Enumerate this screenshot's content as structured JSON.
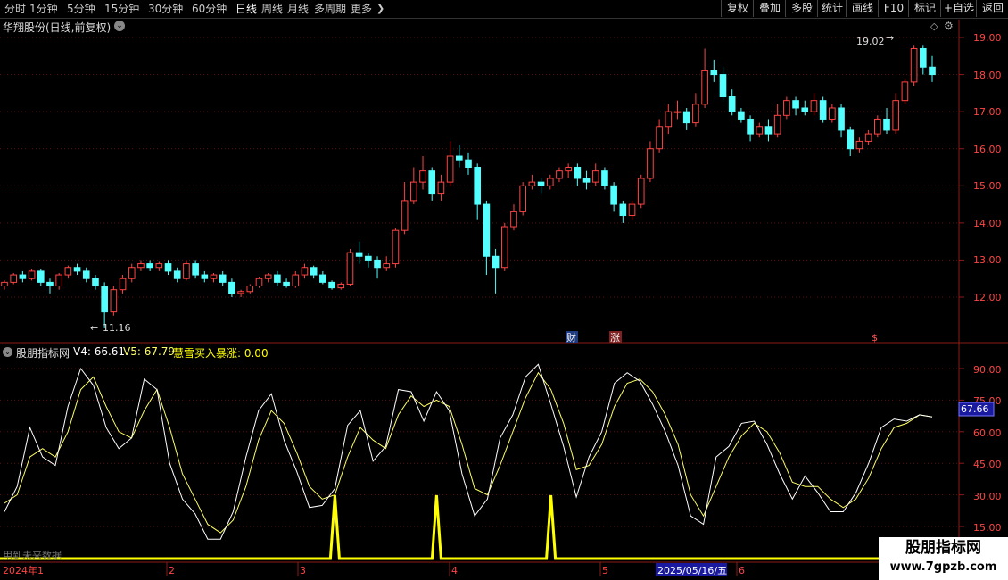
{
  "toolbar": {
    "periods": [
      "分时",
      "1分钟",
      "5分钟",
      "15分钟",
      "30分钟",
      "60分钟",
      "日线",
      "周线",
      "月线",
      "多周期",
      "更多"
    ],
    "active_period": "日线",
    "right_buttons": [
      "复权",
      "叠加",
      "多股",
      "统计",
      "画线",
      "F10",
      "标记",
      "+自选",
      "返回"
    ]
  },
  "chart": {
    "title": "华翔股份(日线,前复权)",
    "price_ticks": [
      "19.00",
      "18.00",
      "17.00",
      "16.00",
      "15.00",
      "14.00",
      "13.00",
      "12.00"
    ],
    "high_marker": "19.02",
    "low_marker": "11.16",
    "event_markers": [
      "财",
      "涨",
      "$"
    ]
  },
  "indicator": {
    "name": "股朋指标网",
    "v4_label": "V4: 66.61",
    "v5_label": "V5: 67.79",
    "signal_label": "慧雪买入暴涨: 0.00",
    "ticks": [
      "90.00",
      "75.00",
      "60.00",
      "45.00",
      "30.00",
      "15.00"
    ],
    "current_value": "67.66",
    "colors": {
      "v4": "#ffffff",
      "v5": "#ffff66",
      "signal": "#ffff00",
      "up": "#ff4444",
      "down": "#54ffff"
    }
  },
  "footer": {
    "note": "用到未来数据",
    "date_labels": [
      "2024年1",
      "2",
      "3",
      "4",
      "5",
      "6"
    ],
    "cursor_date": "2025/05/16/五"
  },
  "watermark": {
    "line1": "股朋指标网",
    "line2": "www.7gpzb.com"
  },
  "chart_data": {
    "type": "candlestick",
    "y_axis_ticks": [
      12,
      13,
      14,
      15,
      16,
      17,
      18,
      19
    ],
    "candles": [
      [
        12.3,
        12.4,
        12.2,
        12.45
      ],
      [
        12.4,
        12.6,
        12.35,
        12.65
      ],
      [
        12.6,
        12.5,
        12.4,
        12.7
      ],
      [
        12.5,
        12.7,
        12.45,
        12.75
      ],
      [
        12.7,
        12.4,
        12.3,
        12.75
      ],
      [
        12.4,
        12.3,
        12.1,
        12.5
      ],
      [
        12.3,
        12.6,
        12.2,
        12.65
      ],
      [
        12.6,
        12.8,
        12.5,
        12.85
      ],
      [
        12.8,
        12.7,
        12.6,
        12.9
      ],
      [
        12.7,
        12.5,
        12.4,
        12.8
      ],
      [
        12.5,
        12.3,
        12.2,
        12.6
      ],
      [
        12.3,
        11.6,
        11.16,
        12.4
      ],
      [
        11.6,
        12.2,
        11.5,
        12.3
      ],
      [
        12.2,
        12.5,
        12.1,
        12.6
      ],
      [
        12.5,
        12.8,
        12.4,
        12.9
      ],
      [
        12.8,
        12.9,
        12.7,
        13.0
      ],
      [
        12.9,
        12.8,
        12.7,
        13.0
      ],
      [
        12.8,
        12.9,
        12.7,
        12.95
      ],
      [
        12.9,
        12.7,
        12.6,
        13.0
      ],
      [
        12.7,
        12.5,
        12.4,
        12.8
      ],
      [
        12.5,
        12.9,
        12.45,
        13.0
      ],
      [
        12.9,
        12.6,
        12.5,
        13.0
      ],
      [
        12.6,
        12.5,
        12.4,
        12.7
      ],
      [
        12.5,
        12.6,
        12.4,
        12.65
      ],
      [
        12.6,
        12.4,
        12.3,
        12.7
      ],
      [
        12.4,
        12.1,
        12.0,
        12.5
      ],
      [
        12.1,
        12.15,
        12.0,
        12.2
      ],
      [
        12.15,
        12.3,
        12.1,
        12.35
      ],
      [
        12.3,
        12.5,
        12.25,
        12.55
      ],
      [
        12.5,
        12.6,
        12.4,
        12.65
      ],
      [
        12.6,
        12.4,
        12.3,
        12.7
      ],
      [
        12.4,
        12.3,
        12.25,
        12.5
      ],
      [
        12.3,
        12.6,
        12.25,
        12.7
      ],
      [
        12.6,
        12.8,
        12.5,
        12.9
      ],
      [
        12.8,
        12.6,
        12.5,
        12.85
      ],
      [
        12.6,
        12.4,
        12.35,
        12.7
      ],
      [
        12.4,
        12.25,
        12.2,
        12.45
      ],
      [
        12.25,
        12.35,
        12.2,
        12.4
      ],
      [
        12.35,
        13.2,
        12.3,
        13.3
      ],
      [
        13.2,
        13.1,
        12.9,
        13.5
      ],
      [
        13.1,
        13.0,
        12.8,
        13.2
      ],
      [
        13.0,
        12.8,
        12.5,
        13.1
      ],
      [
        12.8,
        12.9,
        12.7,
        13.1
      ],
      [
        12.9,
        13.8,
        12.8,
        13.85
      ],
      [
        13.8,
        14.6,
        13.7,
        15.1
      ],
      [
        14.6,
        15.1,
        14.5,
        15.5
      ],
      [
        15.1,
        15.4,
        14.9,
        15.8
      ],
      [
        15.4,
        14.8,
        14.6,
        15.5
      ],
      [
        14.8,
        15.1,
        14.6,
        15.3
      ],
      [
        15.1,
        15.8,
        15.0,
        16.2
      ],
      [
        15.8,
        15.7,
        15.5,
        16.1
      ],
      [
        15.7,
        15.5,
        15.3,
        15.9
      ],
      [
        15.5,
        14.5,
        14.1,
        15.6
      ],
      [
        14.5,
        13.1,
        12.6,
        14.6
      ],
      [
        13.1,
        12.8,
        12.1,
        13.3
      ],
      [
        12.8,
        13.9,
        12.7,
        14.0
      ],
      [
        13.9,
        14.3,
        13.8,
        14.5
      ],
      [
        14.3,
        15.0,
        14.2,
        15.1
      ],
      [
        15.0,
        15.1,
        14.9,
        15.3
      ],
      [
        15.1,
        15.0,
        14.8,
        15.2
      ],
      [
        15.0,
        15.2,
        14.9,
        15.3
      ],
      [
        15.2,
        15.4,
        15.1,
        15.5
      ],
      [
        15.4,
        15.5,
        15.2,
        15.6
      ],
      [
        15.5,
        15.2,
        15.0,
        15.6
      ],
      [
        15.2,
        15.1,
        14.9,
        15.4
      ],
      [
        15.1,
        15.4,
        15.0,
        15.6
      ],
      [
        15.4,
        15.0,
        14.9,
        15.5
      ],
      [
        15.0,
        14.5,
        14.3,
        15.1
      ],
      [
        14.5,
        14.2,
        14.0,
        14.6
      ],
      [
        14.2,
        14.5,
        14.1,
        14.6
      ],
      [
        14.5,
        15.2,
        14.4,
        15.3
      ],
      [
        15.2,
        16.0,
        15.1,
        16.2
      ],
      [
        16.0,
        16.6,
        15.9,
        16.8
      ],
      [
        16.6,
        17.0,
        16.4,
        17.2
      ],
      [
        17.0,
        17.0,
        16.8,
        17.3
      ],
      [
        17.0,
        16.7,
        16.5,
        17.1
      ],
      [
        16.7,
        17.2,
        16.6,
        17.5
      ],
      [
        17.2,
        18.1,
        17.1,
        18.7
      ],
      [
        18.1,
        18.0,
        17.8,
        18.4
      ],
      [
        18.0,
        17.4,
        17.3,
        18.2
      ],
      [
        17.4,
        17.0,
        16.9,
        17.6
      ],
      [
        17.0,
        16.8,
        16.7,
        17.1
      ],
      [
        16.8,
        16.4,
        16.2,
        16.9
      ],
      [
        16.4,
        16.6,
        16.3,
        16.7
      ],
      [
        16.6,
        16.4,
        16.2,
        16.8
      ],
      [
        16.4,
        16.9,
        16.3,
        17.2
      ],
      [
        16.9,
        17.3,
        16.8,
        17.4
      ],
      [
        17.3,
        17.1,
        16.9,
        17.4
      ],
      [
        17.1,
        17.0,
        16.9,
        17.3
      ],
      [
        17.0,
        17.3,
        16.9,
        17.5
      ],
      [
        17.3,
        16.8,
        16.7,
        17.4
      ],
      [
        16.8,
        17.1,
        16.7,
        17.2
      ],
      [
        17.1,
        16.5,
        16.3,
        17.2
      ],
      [
        16.5,
        16.0,
        15.8,
        16.6
      ],
      [
        16.0,
        16.2,
        15.9,
        16.3
      ],
      [
        16.2,
        16.4,
        16.1,
        16.5
      ],
      [
        16.4,
        16.8,
        16.3,
        16.9
      ],
      [
        16.8,
        16.5,
        16.4,
        17.1
      ],
      [
        16.5,
        17.3,
        16.4,
        17.5
      ],
      [
        17.3,
        17.8,
        17.2,
        17.9
      ],
      [
        17.8,
        18.7,
        17.7,
        18.8
      ],
      [
        18.7,
        18.2,
        18.0,
        18.8
      ],
      [
        18.2,
        18.0,
        17.8,
        18.5
      ]
    ],
    "v4": [
      22,
      34,
      62,
      48,
      44,
      72,
      90,
      82,
      62,
      52,
      57,
      85,
      80,
      45,
      28,
      21,
      9,
      9,
      22,
      48,
      70,
      78,
      56,
      41,
      24,
      25,
      33,
      63,
      70,
      46,
      53,
      80,
      79,
      65,
      79,
      70,
      40,
      20,
      28,
      57,
      68,
      86,
      92,
      73,
      53,
      29,
      48,
      60,
      83,
      88,
      84,
      73,
      60,
      44,
      20,
      16,
      48,
      53,
      64,
      65,
      54,
      40,
      28,
      39,
      31,
      22,
      22,
      31,
      45,
      62,
      66,
      65,
      68,
      67
    ],
    "v5": [
      26,
      30,
      48,
      52,
      48,
      60,
      80,
      86,
      72,
      60,
      57,
      70,
      80,
      62,
      40,
      28,
      16,
      12,
      18,
      34,
      56,
      70,
      64,
      50,
      34,
      28,
      30,
      48,
      62,
      56,
      52,
      68,
      77,
      72,
      75,
      72,
      54,
      33,
      30,
      44,
      60,
      76,
      88,
      80,
      64,
      42,
      44,
      54,
      72,
      83,
      85,
      79,
      68,
      54,
      30,
      20,
      34,
      48,
      58,
      64,
      60,
      50,
      36,
      34,
      34,
      28,
      24,
      28,
      38,
      52,
      62,
      64,
      68,
      67
    ],
    "signal_spike_indices": [
      26,
      34,
      43
    ]
  }
}
